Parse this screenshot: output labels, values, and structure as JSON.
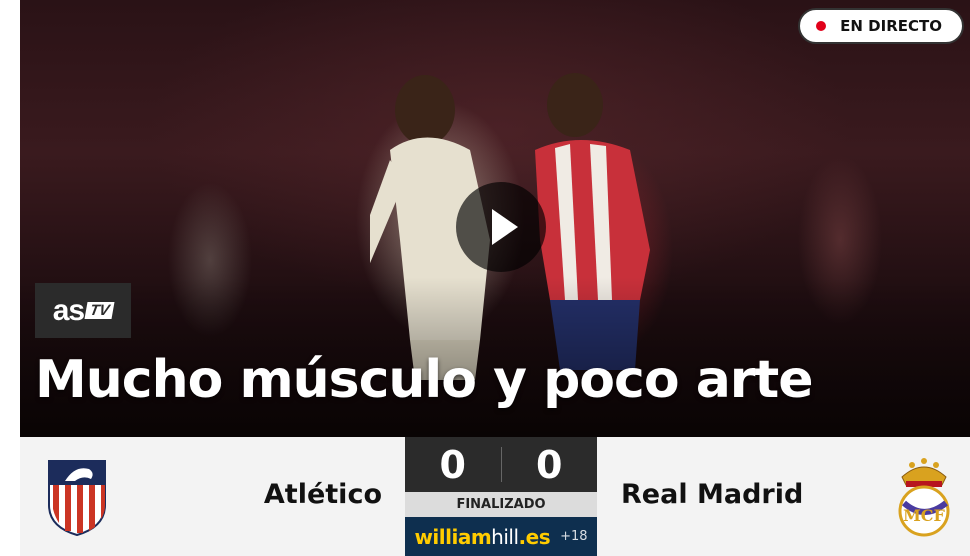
{
  "hero": {
    "live_label": "EN DIRECTO",
    "logo": {
      "part1": "as",
      "part2": "TV"
    },
    "headline": "Mucho músculo y poco arte",
    "play_icon": "play-icon"
  },
  "match": {
    "home": {
      "name": "Atlético",
      "score": "0",
      "crest_icon": "atletico-crest-icon"
    },
    "away": {
      "name": "Real Madrid",
      "score": "0",
      "crest_icon": "real-madrid-crest-icon"
    },
    "status": "FINALIZADO"
  },
  "sponsor": {
    "brand_bold": "william",
    "brand_light": "hill",
    "brand_tld": ".es",
    "age": "+18"
  },
  "colors": {
    "live_dot": "#e1001a",
    "score_bg": "#2b2b2b",
    "status_bg": "#dcdcdc",
    "sponsor_bg": "#0e2f4f",
    "sponsor_accent": "#ffcc00",
    "scorebar_bg": "#f3f3f3"
  }
}
